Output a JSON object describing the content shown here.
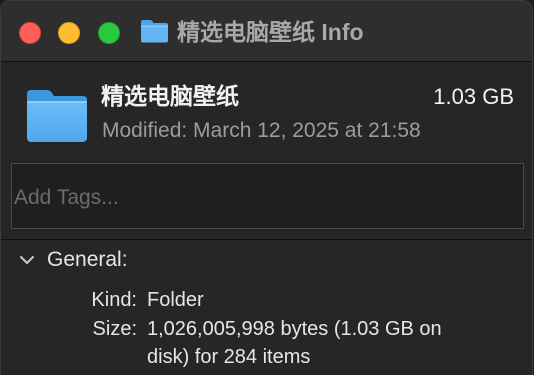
{
  "window": {
    "title": "精选电脑壁纸 Info",
    "folder_icon": "folder-icon"
  },
  "header": {
    "name": "精选电脑壁纸",
    "size": "1.03 GB",
    "modified": "Modified: March 12, 2025 at 21:58"
  },
  "tags": {
    "placeholder": "Add Tags..."
  },
  "general": {
    "label": "General:",
    "kind_label": "Kind:",
    "kind_value": "Folder",
    "size_label": "Size:",
    "size_value_line1": "1,026,005,998 bytes (1.03 GB on",
    "size_value_line2": "disk) for 284 items"
  },
  "colors": {
    "folder_light": "#64b8f5",
    "folder_dark": "#3a8fd9",
    "close": "#ff5f57",
    "minimize": "#febc2e",
    "zoom": "#28c840"
  }
}
